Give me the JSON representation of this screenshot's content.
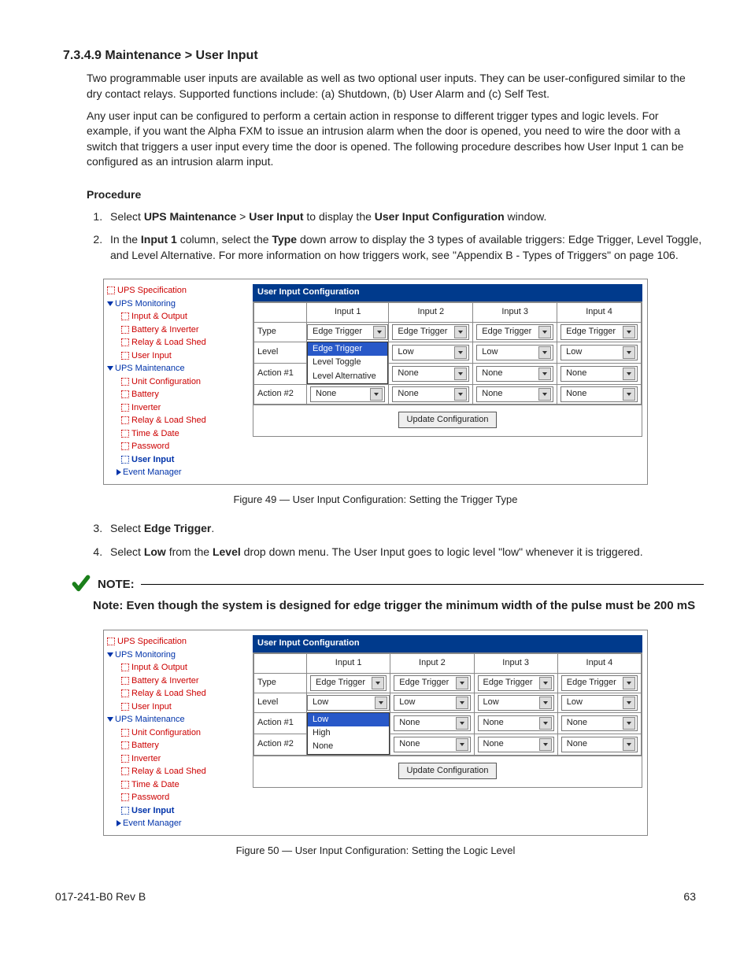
{
  "heading": "7.3.4.9   Maintenance > User Input",
  "para1": "Two programmable user inputs are available as well as two optional user inputs. They can be user-configured similar to the dry contact relays. Supported functions include: (a) Shutdown, (b) User Alarm and (c) Self Test.",
  "para2": "Any user input can be configured to perform a certain action in response to different trigger types and logic levels. For example, if you want the Alpha FXM to issue an intrusion alarm when the door is opened, you need to wire the door with a switch that triggers a user input every time the door is opened. The following procedure describes how User Input 1 can be configured as an intrusion alarm input.",
  "procedure_label": "Procedure",
  "step1_a": "Select ",
  "step1_b": "UPS Maintenance",
  "step1_c": " > ",
  "step1_d": "User Input",
  "step1_e": " to display the ",
  "step1_f": "User Input Configuration",
  "step1_g": " window.",
  "step2_a": "In the ",
  "step2_b": "Input 1",
  "step2_c": " column, select the ",
  "step2_d": "Type",
  "step2_e": " down arrow to display the 3 types of available triggers: Edge Trigger, Level Toggle, and Level Alternative. For more information on how triggers work, see \"Appendix B - Types of Triggers\" on page 106.",
  "step3_a": "Select ",
  "step3_b": "Edge Trigger",
  "step3_c": ".",
  "step4_a": "Select ",
  "step4_b": "Low",
  "step4_c": " from the ",
  "step4_d": "Level",
  "step4_e": " drop down menu. The User Input goes to logic level \"low\" whenever it is triggered.",
  "fig49": "Figure 49  —  User Input Configuration: Setting the Trigger Type",
  "fig50": "Figure 50  —  User Input Configuration: Setting the Logic Level",
  "note_title": "NOTE:",
  "note_body": "Note: Even though the system is designed for edge trigger the minimum width of the pulse must be 200 mS",
  "footer_left": "017-241-B0    Rev B",
  "footer_right": "63",
  "tree": {
    "spec": "UPS Specification",
    "mon": "UPS Monitoring",
    "io": "Input & Output",
    "bi": "Battery & Inverter",
    "rls": "Relay & Load Shed",
    "ui": "User Input",
    "maint": "UPS Maintenance",
    "uc": "Unit Configuration",
    "bat": "Battery",
    "inv": "Inverter",
    "rls2": "Relay & Load Shed",
    "td": "Time & Date",
    "pw": "Password",
    "ui2": "User Input",
    "em": "Event Manager"
  },
  "panel": {
    "title": "User Input Configuration",
    "cols": {
      "c1": "Input 1",
      "c2": "Input 2",
      "c3": "Input 3",
      "c4": "Input 4"
    },
    "rows": {
      "type": "Type",
      "level": "Level",
      "a1": "Action #1",
      "a2": "Action #2"
    },
    "edge": "Edge Trigger",
    "low": "Low",
    "high": "High",
    "none": "None",
    "lvltog": "Level Toggle",
    "lvlalt": "Level Alternative",
    "update": "Update Configuration"
  }
}
